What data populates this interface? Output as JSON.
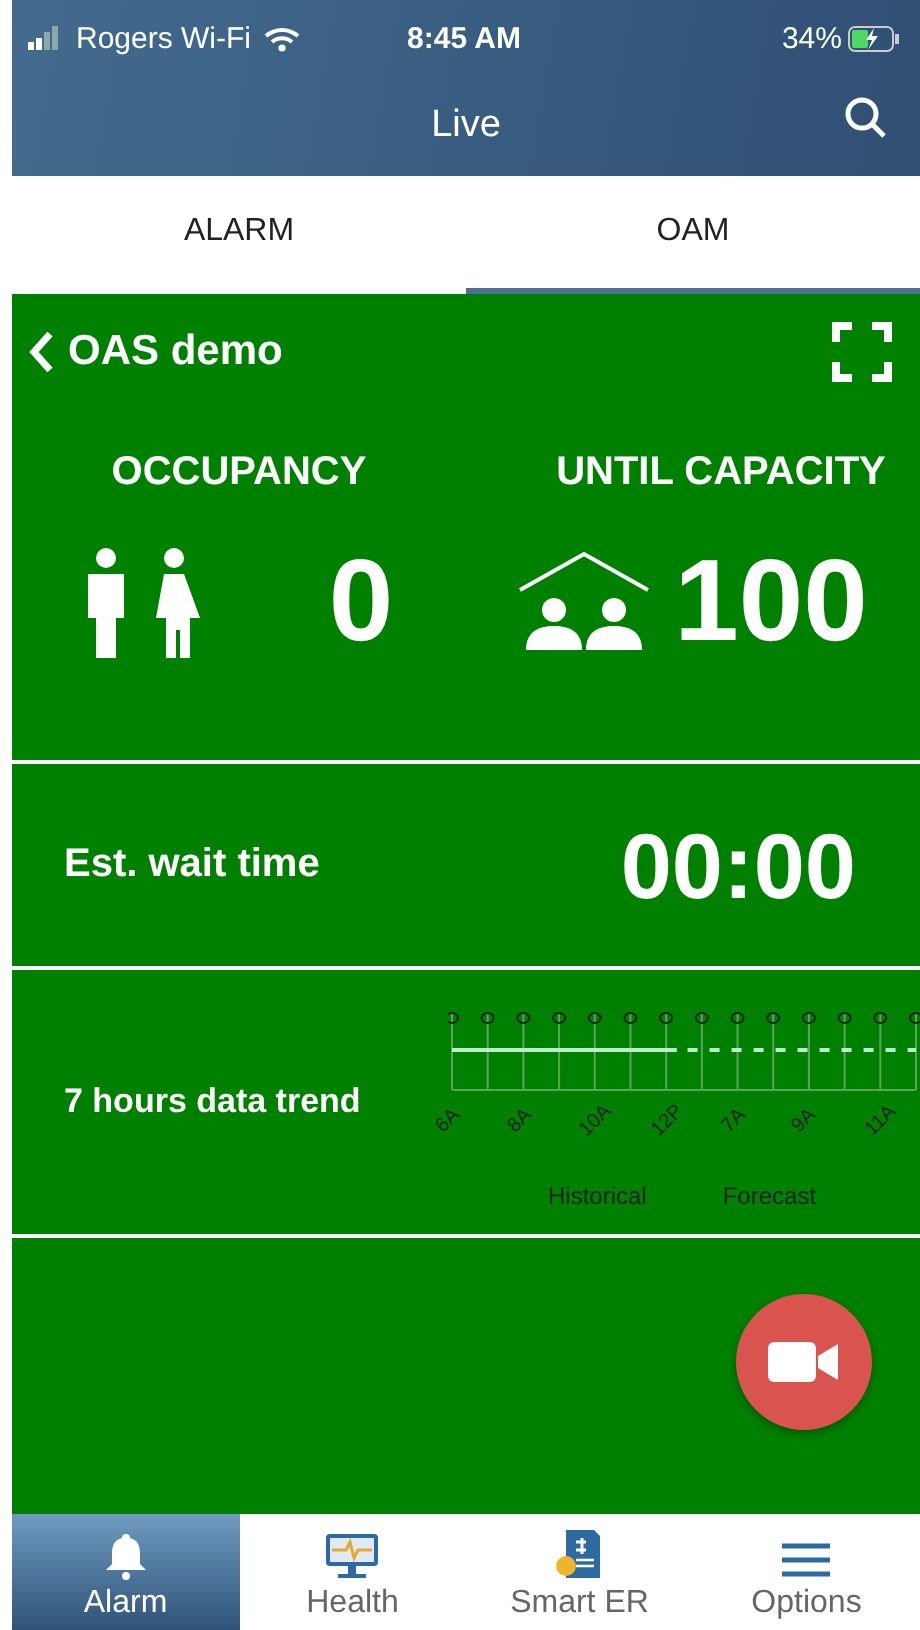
{
  "status_bar": {
    "carrier": "Rogers Wi-Fi",
    "time": "8:45 AM",
    "battery": "34%"
  },
  "header": {
    "title": "Live"
  },
  "tabs": [
    {
      "label": "ALARM",
      "selected": false
    },
    {
      "label": "OAM",
      "selected": true
    }
  ],
  "location": {
    "name": "OAS demo"
  },
  "stats": [
    {
      "kind": "people",
      "label": "OCCUPANCY",
      "value": "0"
    },
    {
      "kind": "capacity",
      "label": "UNTIL CAPACITY",
      "value": "100"
    }
  ],
  "wait": {
    "label": "Est. wait time",
    "value": "00:00"
  },
  "trend": {
    "label": "7 hours data trend",
    "axis_labels": [
      "6A",
      "8A",
      "10A",
      "12P",
      "7A",
      "9A",
      "11A"
    ],
    "legend": [
      "Historical",
      "Forecast"
    ]
  },
  "nav": [
    {
      "kind": "bell",
      "label": "Alarm",
      "selected": true
    },
    {
      "kind": "monitor",
      "label": "Health",
      "selected": false
    },
    {
      "kind": "bill",
      "label": "Smart ER",
      "selected": false
    },
    {
      "kind": "menu",
      "label": "Options",
      "selected": false
    }
  ]
}
